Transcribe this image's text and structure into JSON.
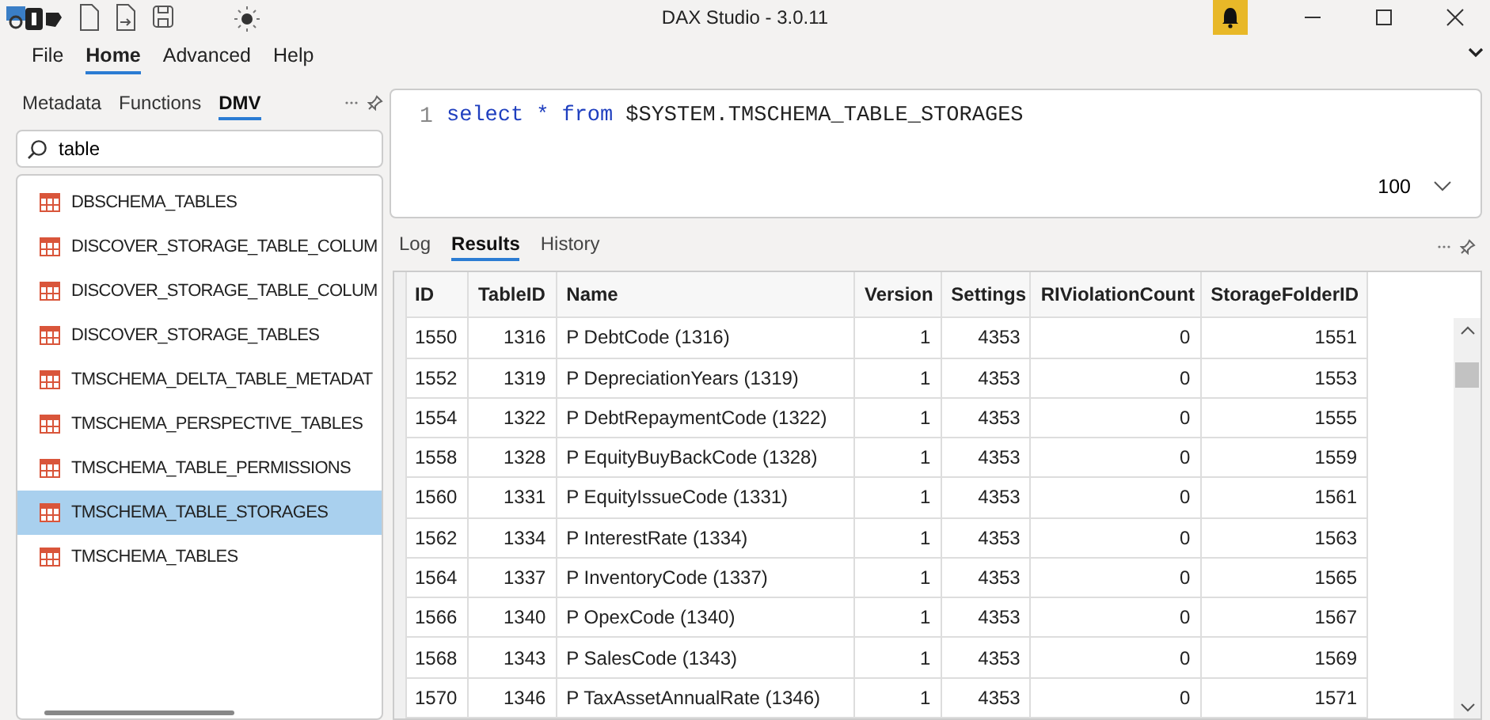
{
  "window": {
    "title": "DAX Studio - 3.0.11"
  },
  "menu": [
    {
      "label": "File",
      "selected": false
    },
    {
      "label": "Home",
      "selected": true
    },
    {
      "label": "Advanced",
      "selected": false
    },
    {
      "label": "Help",
      "selected": false
    }
  ],
  "sidebar": {
    "tabs": [
      {
        "label": "Metadata",
        "selected": false
      },
      {
        "label": "Functions",
        "selected": false
      },
      {
        "label": "DMV",
        "selected": true
      }
    ],
    "search": {
      "value": "table"
    },
    "items": [
      {
        "label": "DBSCHEMA_TABLES",
        "selected": false
      },
      {
        "label": "DISCOVER_STORAGE_TABLE_COLUM",
        "selected": false
      },
      {
        "label": "DISCOVER_STORAGE_TABLE_COLUM",
        "selected": false
      },
      {
        "label": "DISCOVER_STORAGE_TABLES",
        "selected": false
      },
      {
        "label": "TMSCHEMA_DELTA_TABLE_METADAT",
        "selected": false
      },
      {
        "label": "TMSCHEMA_PERSPECTIVE_TABLES",
        "selected": false
      },
      {
        "label": "TMSCHEMA_TABLE_PERMISSIONS",
        "selected": false
      },
      {
        "label": "TMSCHEMA_TABLE_STORAGES",
        "selected": true
      },
      {
        "label": "TMSCHEMA_TABLES",
        "selected": false
      }
    ]
  },
  "editor": {
    "line_number": "1",
    "query": [
      {
        "text": "select",
        "kind": "keyword"
      },
      {
        "text": "*",
        "kind": "keyword"
      },
      {
        "text": "from",
        "kind": "keyword"
      },
      {
        "text": "$SYSTEM.TMSCHEMA_TABLE_STORAGES",
        "kind": "plain"
      }
    ],
    "row_limit": "100"
  },
  "results": {
    "tabs": [
      {
        "label": "Log",
        "selected": false
      },
      {
        "label": "Results",
        "selected": true
      },
      {
        "label": "History",
        "selected": false
      }
    ],
    "columns": [
      {
        "label": "ID",
        "kind": "key"
      },
      {
        "label": "TableID",
        "kind": "number"
      },
      {
        "label": "Name",
        "kind": "text"
      },
      {
        "label": "Version",
        "kind": "number"
      },
      {
        "label": "Settings",
        "kind": "number"
      },
      {
        "label": "RIViolationCount",
        "kind": "number"
      },
      {
        "label": "StorageFolderID",
        "kind": "number"
      }
    ],
    "rows": [
      [
        "1550",
        "1316",
        "P DebtCode (1316)",
        "1",
        "4353",
        "0",
        "1551"
      ],
      [
        "1552",
        "1319",
        "P DepreciationYears (1319)",
        "1",
        "4353",
        "0",
        "1553"
      ],
      [
        "1554",
        "1322",
        "P DebtRepaymentCode (1322)",
        "1",
        "4353",
        "0",
        "1555"
      ],
      [
        "1558",
        "1328",
        "P EquityBuyBackCode (1328)",
        "1",
        "4353",
        "0",
        "1559"
      ],
      [
        "1560",
        "1331",
        "P EquityIssueCode (1331)",
        "1",
        "4353",
        "0",
        "1561"
      ],
      [
        "1562",
        "1334",
        "P InterestRate (1334)",
        "1",
        "4353",
        "0",
        "1563"
      ],
      [
        "1564",
        "1337",
        "P InventoryCode (1337)",
        "1",
        "4353",
        "0",
        "1565"
      ],
      [
        "1566",
        "1340",
        "P OpexCode (1340)",
        "1",
        "4353",
        "0",
        "1567"
      ],
      [
        "1568",
        "1343",
        "P SalesCode (1343)",
        "1",
        "4353",
        "0",
        "1569"
      ],
      [
        "1570",
        "1346",
        "P TaxAssetAnnualRate (1346)",
        "1",
        "4353",
        "0",
        "1571"
      ]
    ]
  }
}
